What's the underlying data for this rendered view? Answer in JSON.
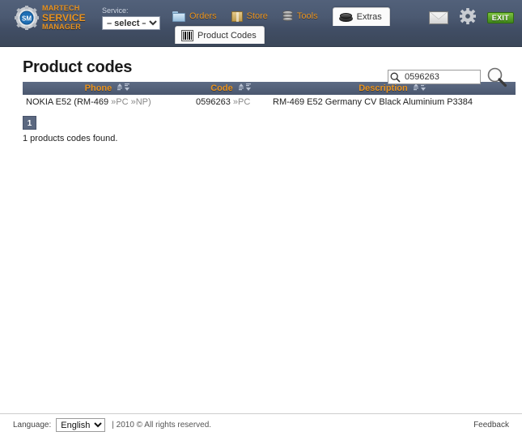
{
  "header": {
    "logo": {
      "badge": "SM",
      "line1": "MARTECH",
      "line2": "SERVICE",
      "line3": "MANAGER"
    },
    "service": {
      "label": "Service:",
      "selected": "– select –",
      "options": [
        "– select –"
      ]
    },
    "nav": [
      {
        "id": "orders",
        "label": "Orders",
        "icon": "folder-icon",
        "active": false
      },
      {
        "id": "store",
        "label": "Store",
        "icon": "box-icon",
        "active": false
      },
      {
        "id": "tools",
        "label": "Tools",
        "icon": "database-icon",
        "active": false
      },
      {
        "id": "extras",
        "label": "Extras",
        "icon": "disc-icon",
        "active": true
      }
    ],
    "subtab": {
      "label": "Product Codes",
      "icon": "barcode-icon"
    },
    "actions": [
      {
        "id": "mail",
        "label": "",
        "icon": "mail-icon"
      },
      {
        "id": "settings",
        "label": "",
        "icon": "gear-icon"
      },
      {
        "id": "exit",
        "label": "EXIT",
        "icon": "exit-icon"
      }
    ]
  },
  "main": {
    "title": "Product codes",
    "search": {
      "value": "0596263",
      "placeholder": ""
    },
    "table": {
      "columns": [
        {
          "key": "phone",
          "label": "Phone"
        },
        {
          "key": "code",
          "label": "Code"
        },
        {
          "key": "description",
          "label": "Description"
        }
      ],
      "rows": [
        {
          "phone": "NOKIA E52 (RM-469 ",
          "phone_tag1": "»PC ",
          "phone_tag2": "»NP)",
          "code": "0596263 ",
          "code_tag": "»PC",
          "description": "RM-469 E52 Germany CV Black Aluminium P3384"
        }
      ]
    },
    "pagination": {
      "pages": [
        "1"
      ],
      "current": "1"
    },
    "result_text": "1 products codes found."
  },
  "footer": {
    "language_label": "Language:",
    "language_selected": "English",
    "language_options": [
      "English"
    ],
    "copyright": "| 2010 © All rights reserved.",
    "feedback": "Feedback"
  },
  "colors": {
    "header_top": "#52617a",
    "header_bottom": "#3b4759",
    "accent_orange": "#e8921e",
    "table_header": "#5d6b84",
    "exit_green": "#3f8719"
  }
}
